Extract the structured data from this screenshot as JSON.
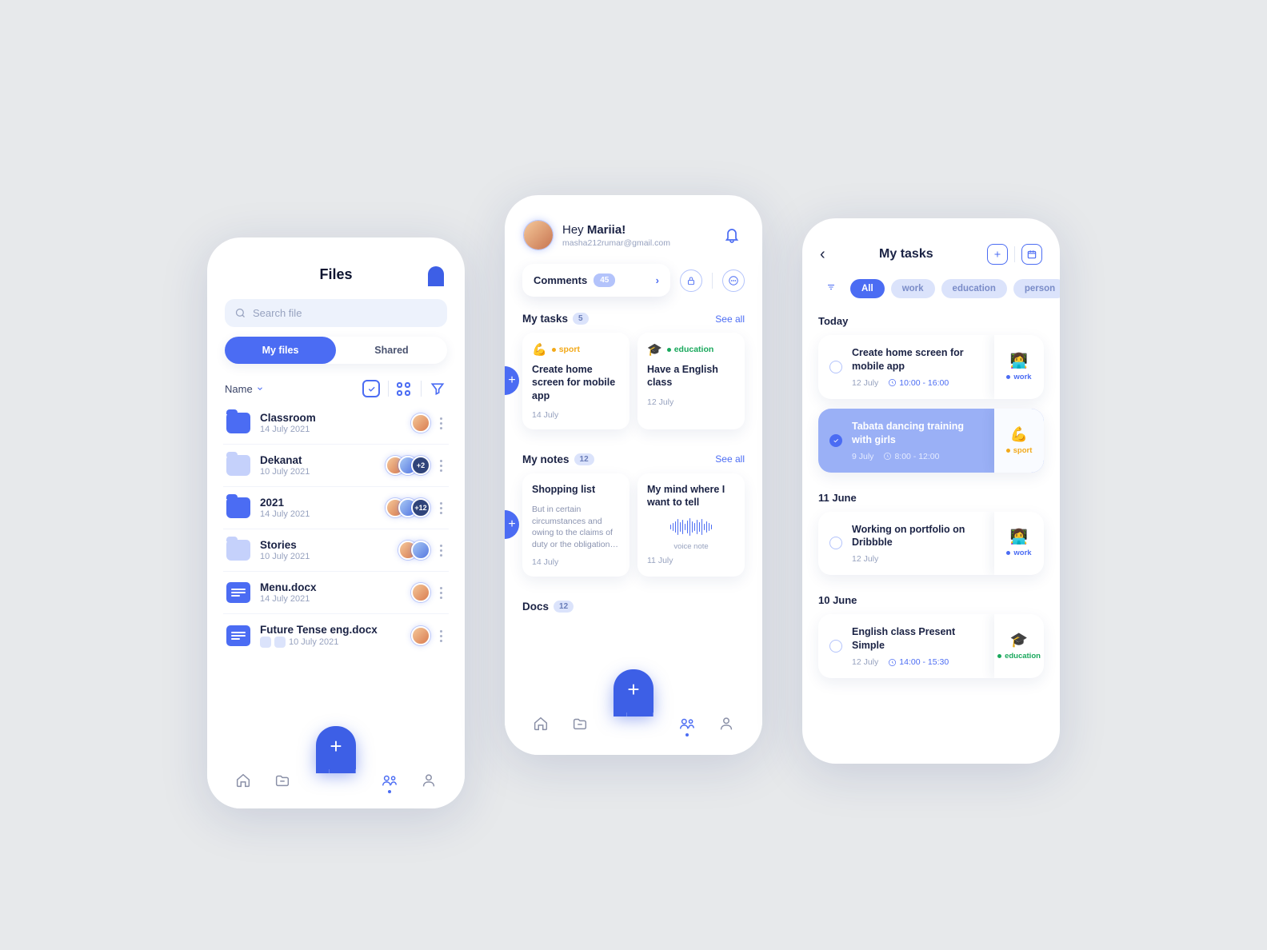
{
  "files_screen": {
    "title": "Files",
    "search_placeholder": "Search file",
    "tabs": {
      "my_files": "My files",
      "shared": "Shared"
    },
    "sort_label": "Name",
    "files": [
      {
        "name": "Classroom",
        "date": "14 July 2021",
        "type": "folder",
        "avatars": 1
      },
      {
        "name": "Dekanat",
        "date": "10 July 2021",
        "type": "folder-light",
        "avatars": 2,
        "more": "+2"
      },
      {
        "name": "2021",
        "date": "14 July 2021",
        "type": "folder",
        "avatars": 2,
        "more": "+12"
      },
      {
        "name": "Stories",
        "date": "10 July 2021",
        "type": "folder-light",
        "avatars": 2
      },
      {
        "name": "Menu.docx",
        "date": "14 July 2021",
        "type": "doc",
        "avatars": 1
      },
      {
        "name": "Future Tense eng.docx",
        "date": "10 July 2021",
        "type": "doc",
        "avatars": 1,
        "badges": true
      }
    ]
  },
  "home_screen": {
    "greeting_prefix": "Hey ",
    "user_name": "Mariia!",
    "email": "masha212rumar@gmail.com",
    "comments": {
      "label": "Comments",
      "count": "45"
    },
    "tasks": {
      "label": "My tasks",
      "count": "5",
      "see_all": "See all",
      "items": [
        {
          "emoji": "💪",
          "tag": "sport",
          "tag_class": "sport",
          "title": "Create home screen for mobile app",
          "date": "14 July"
        },
        {
          "emoji": "🎓",
          "tag": "education",
          "tag_class": "edu",
          "title": "Have a English class",
          "date": "12 July"
        }
      ]
    },
    "notes": {
      "label": "My notes",
      "count": "12",
      "see_all": "See all",
      "items": [
        {
          "title": "Shopping list",
          "excerpt": "But in certain circumstances and owing to the claims of duty or the obligation…",
          "date": "14 July"
        },
        {
          "title": "My mind where I want to tell",
          "voice_label": "voice note",
          "date": "11 July"
        }
      ]
    },
    "docs": {
      "label": "Docs",
      "count": "12"
    }
  },
  "tasks_screen": {
    "title": "My tasks",
    "filters": [
      "All",
      "work",
      "education",
      "person"
    ],
    "sections": [
      {
        "label": "Today",
        "tasks": [
          {
            "title": "Create home screen for mobile app",
            "date": "12 July",
            "time": "10:00 - 16:00",
            "emoji": "👩‍💻",
            "tag": "work",
            "tag_class": "work",
            "done": false
          },
          {
            "title": "Tabata dancing training with girls",
            "date": "9 July",
            "time": "8:00 - 12:00",
            "emoji": "💪",
            "tag": "sport",
            "tag_class": "sport",
            "done": true
          }
        ]
      },
      {
        "label": "11 June",
        "tasks": [
          {
            "title": "Working on portfolio on Dribbble",
            "date": "12 July",
            "emoji": "👩‍💻",
            "tag": "work",
            "tag_class": "work"
          }
        ]
      },
      {
        "label": "10 June",
        "tasks": [
          {
            "title": "English class Present Simple",
            "date": "12 July",
            "time": "14:00 - 15:30",
            "emoji": "🎓",
            "tag": "education",
            "tag_class": "edu"
          }
        ]
      }
    ]
  }
}
